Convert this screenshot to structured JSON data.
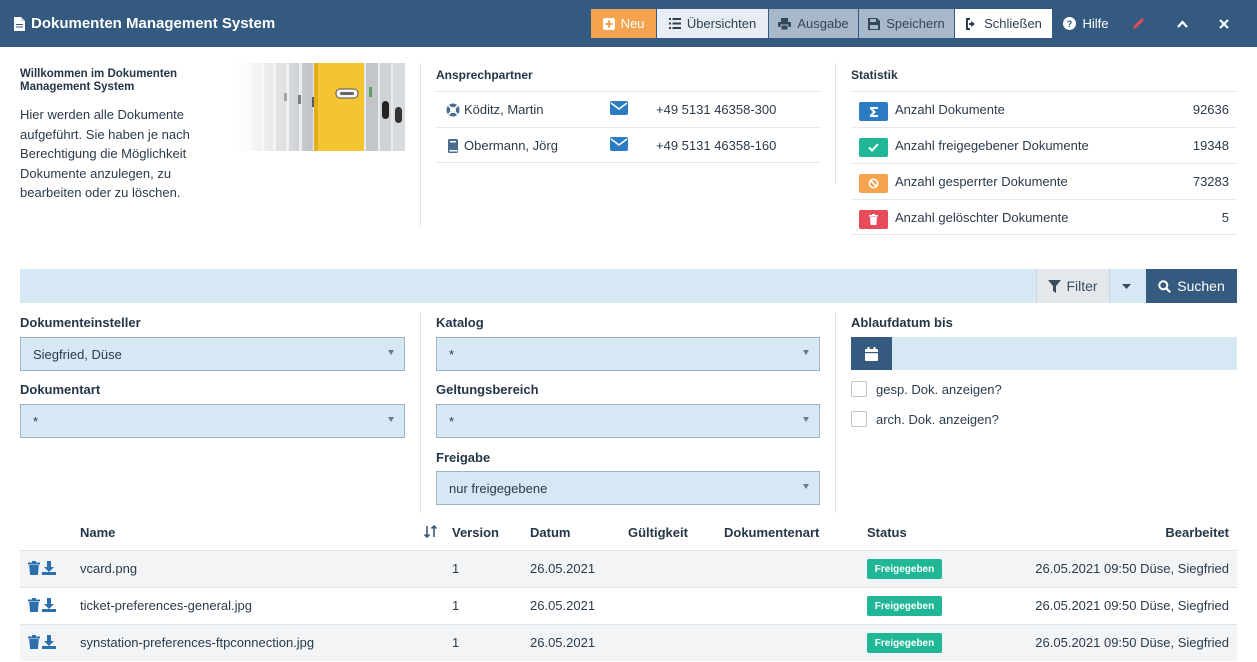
{
  "app": {
    "title": "Dokumenten Management System"
  },
  "toolbar": {
    "neu": "Neu",
    "uebersichten": "Übersichten",
    "ausgabe": "Ausgabe",
    "speichern": "Speichern",
    "schliessen": "Schließen",
    "hilfe": "Hilfe"
  },
  "welcome": {
    "title": "Willkommen im Dokumenten Management System",
    "text": "Hier werden alle Dokumente aufgeführt. Sie haben je nach Berechtigung die Möglichkeit Dokumente anzulegen, zu bearbeiten oder zu löschen."
  },
  "contacts": {
    "title": "Ansprechpartner",
    "items": [
      {
        "name": "Köditz, Martin",
        "phone": "+49 5131 46358-300",
        "icon": "support-icon"
      },
      {
        "name": "Obermann, Jörg",
        "phone": "+49 5131 46358-160",
        "icon": "book-icon"
      }
    ]
  },
  "stats": {
    "title": "Statistik",
    "items": [
      {
        "label": "Anzahl Dokumente",
        "value": "92636",
        "color": "#2c7cc4",
        "icon": "sigma-icon"
      },
      {
        "label": "Anzahl freigegebener Dokumente",
        "value": "19348",
        "color": "#1fb795",
        "icon": "check-icon"
      },
      {
        "label": "Anzahl gesperrter Dokumente",
        "value": "73283",
        "color": "#f5a34e",
        "icon": "ban-icon"
      },
      {
        "label": "Anzahl gelöschter Dokumente",
        "value": "5",
        "color": "#e84b5a",
        "icon": "trash-icon"
      }
    ]
  },
  "filterbar": {
    "filter": "Filter",
    "search": "Suchen"
  },
  "form": {
    "einsteller_label": "Dokumenteinsteller",
    "einsteller_value": "Siegfried, Düse",
    "dokumentart_label": "Dokumentart",
    "dokumentart_value": "*",
    "katalog_label": "Katalog",
    "katalog_value": "*",
    "geltungsbereich_label": "Geltungsbereich",
    "geltungsbereich_value": "*",
    "freigabe_label": "Freigabe",
    "freigabe_value": "nur freigegebene",
    "ablauf_label": "Ablaufdatum bis",
    "chk_gesp": "gesp. Dok. anzeigen?",
    "chk_arch": "arch. Dok. anzeigen?"
  },
  "table": {
    "headers": {
      "name": "Name",
      "version": "Version",
      "datum": "Datum",
      "gueltigkeit": "Gültigkeit",
      "dokumentenart": "Dokumentenart",
      "status": "Status",
      "bearbeitet": "Bearbeitet"
    },
    "rows": [
      {
        "name": "vcard.png",
        "version": "1",
        "datum": "26.05.2021",
        "status": "Freigegeben",
        "bearbeitet": "26.05.2021 09:50 Düse, Siegfried"
      },
      {
        "name": "ticket-preferences-general.jpg",
        "version": "1",
        "datum": "26.05.2021",
        "status": "Freigegeben",
        "bearbeitet": "26.05.2021 09:50 Düse, Siegfried"
      },
      {
        "name": "synstation-preferences-ftpconnection.jpg",
        "version": "1",
        "datum": "26.05.2021",
        "status": "Freigegeben",
        "bearbeitet": "26.05.2021 09:50 Düse, Siegfried"
      }
    ]
  }
}
